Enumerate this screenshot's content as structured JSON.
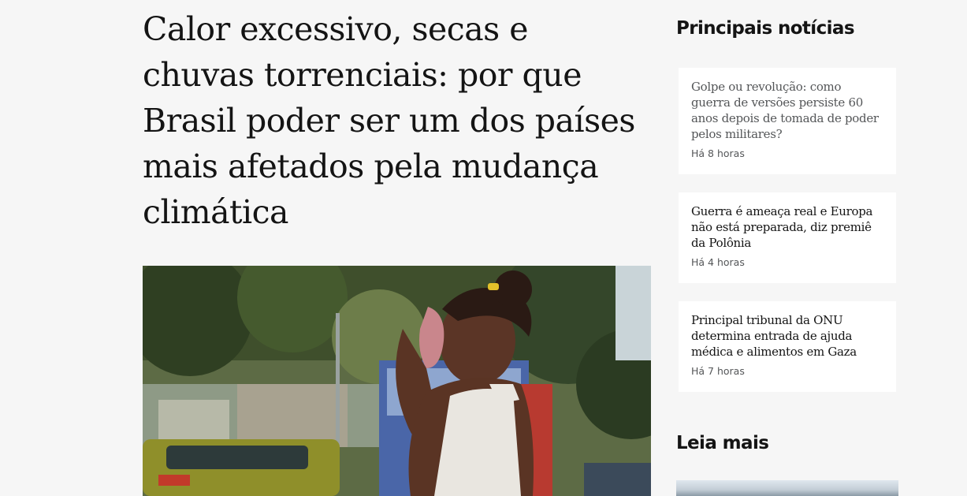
{
  "article": {
    "headline": "Calor excessivo, secas e chuvas torrenciais: por que Brasil poder ser um dos países mais afetados pela mudança climática"
  },
  "sidebar": {
    "top_news_title": "Principais notícias",
    "items": [
      {
        "headline": "Golpe ou revolução: como guerra de versões persiste 60 anos depois de tomada de poder pelos militares?",
        "time": "Há 8 horas"
      },
      {
        "headline": "Guerra é ameaça real e Europa não está preparada, diz premiê da Polônia",
        "time": "Há 4 horas"
      },
      {
        "headline": "Principal tribunal da ONU determina entrada de ajuda médica e alimentos em Gaza",
        "time": "Há 7 horas"
      }
    ],
    "read_more_title": "Leia mais"
  }
}
